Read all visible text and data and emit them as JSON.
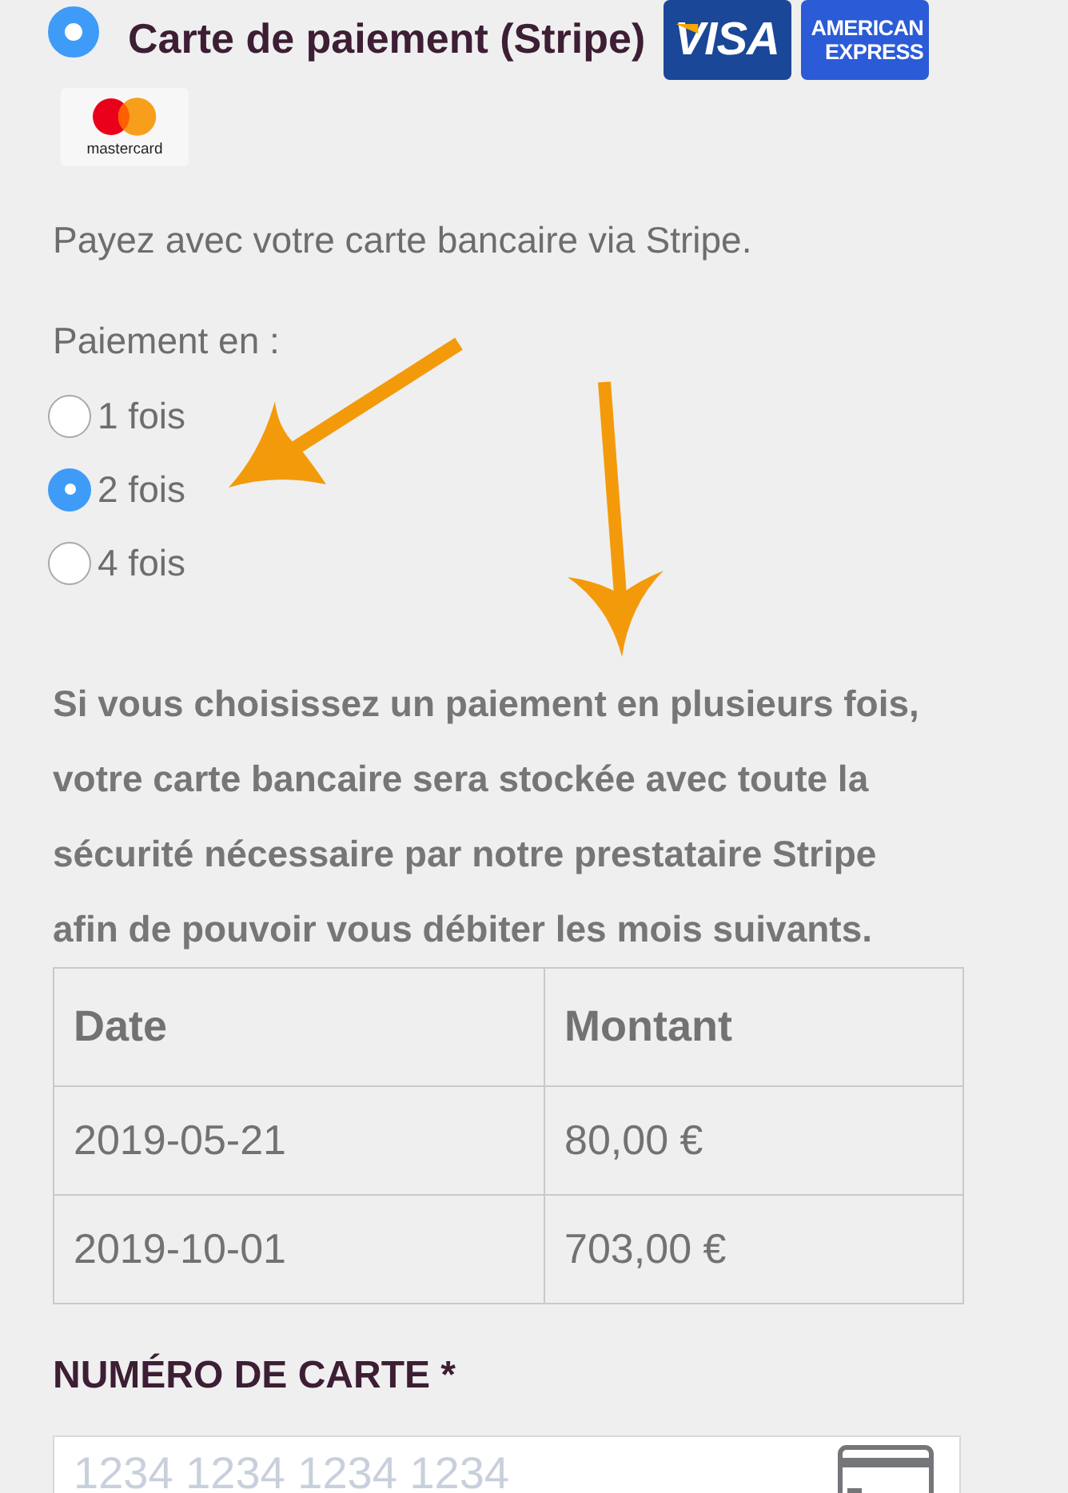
{
  "payment_method": {
    "label": "Carte de paiement (Stripe)",
    "selected": true,
    "card_logos": [
      {
        "kind": "visa",
        "text": "VISA"
      },
      {
        "kind": "amex",
        "text": "AMERICAN EXPRESS"
      },
      {
        "kind": "mastercard",
        "text": "mastercard"
      }
    ]
  },
  "description": "Payez avec votre carte bancaire via Stripe.",
  "installments": {
    "label": "Paiement en :",
    "options": [
      {
        "label": "1 fois",
        "selected": false
      },
      {
        "label": "2 fois",
        "selected": true
      },
      {
        "label": "4 fois",
        "selected": false
      }
    ]
  },
  "notice": "Si vous choisissez un paiement en plusieurs fois, votre carte bancaire sera stockée avec toute la sécurité nécessaire par notre prestataire Stripe afin de pouvoir vous débiter les mois suivants.",
  "schedule_table": {
    "columns": [
      "Date",
      "Montant"
    ],
    "rows": [
      [
        "2019-05-21",
        "80,00 €"
      ],
      [
        "2019-10-01",
        "703,00 €"
      ]
    ]
  },
  "card_number": {
    "label": "NUMÉRO DE CARTE *",
    "placeholder": "1234 1234 1234 1234"
  }
}
